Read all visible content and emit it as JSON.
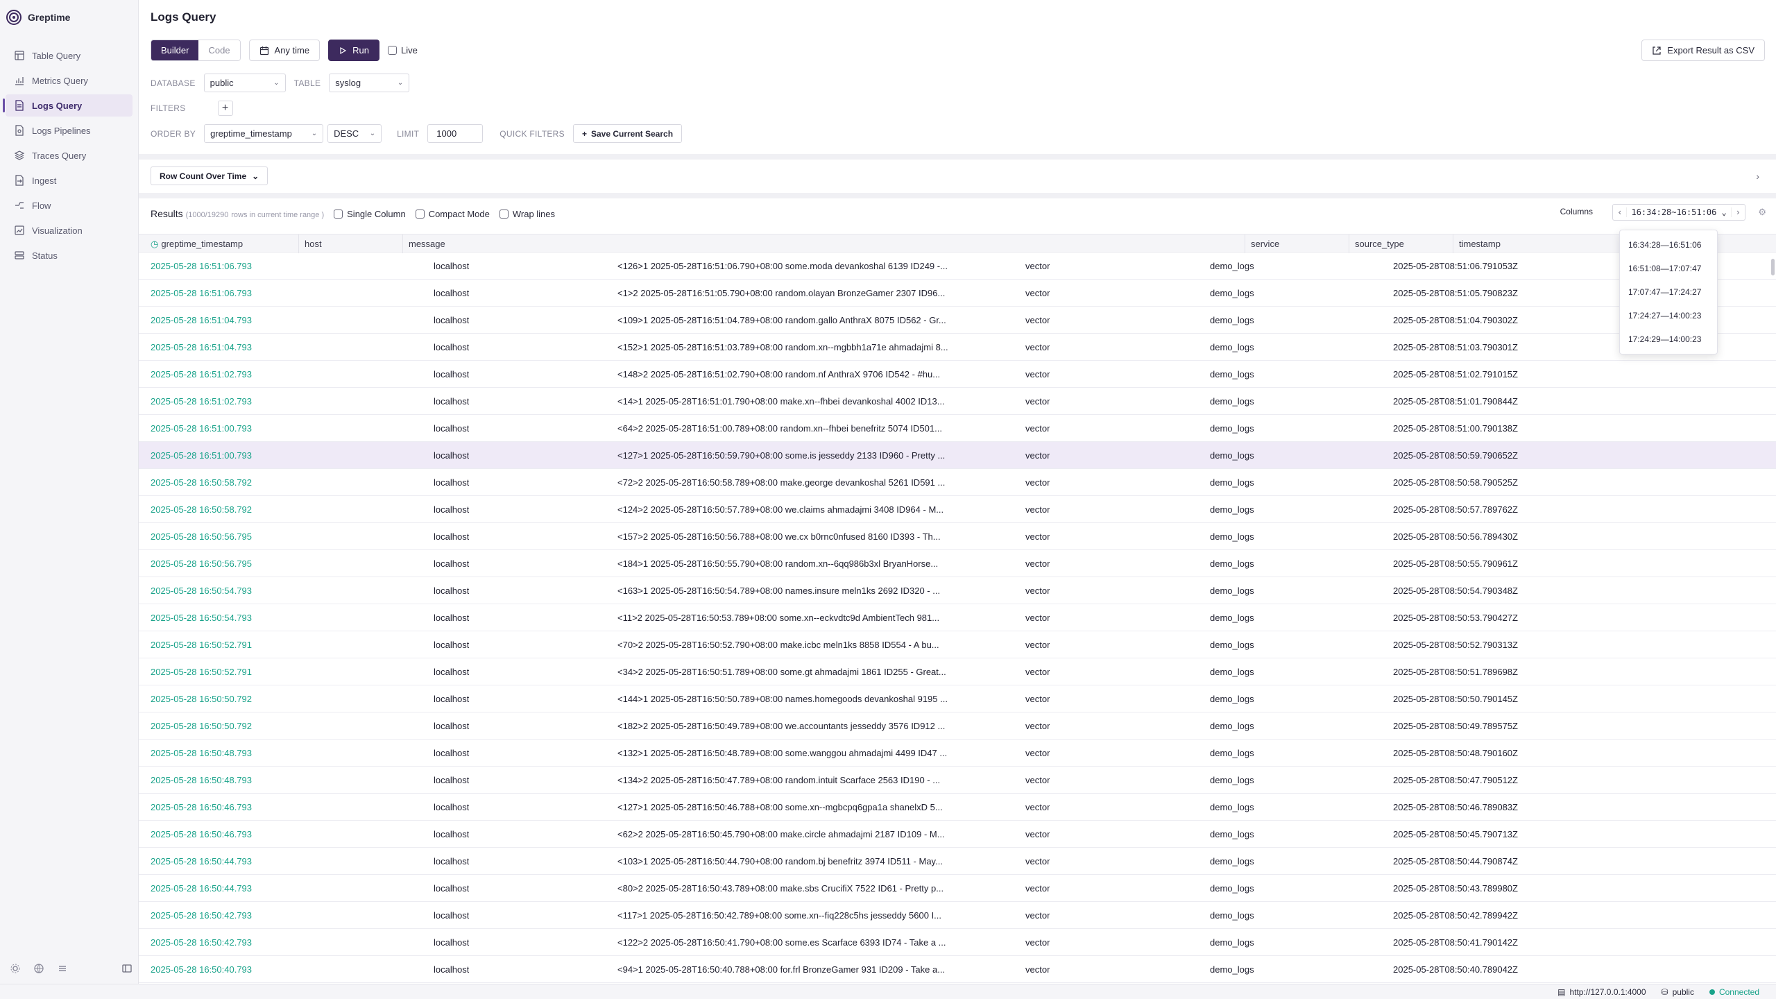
{
  "app": {
    "name": "Greptime"
  },
  "sidebar": {
    "items": [
      {
        "label": "Table Query",
        "icon": "table-icon"
      },
      {
        "label": "Metrics Query",
        "icon": "chart-icon"
      },
      {
        "label": "Logs Query",
        "icon": "document-icon",
        "active": true
      },
      {
        "label": "Logs Pipelines",
        "icon": "pipeline-icon"
      },
      {
        "label": "Traces Query",
        "icon": "layers-icon"
      },
      {
        "label": "Ingest",
        "icon": "ingest-icon"
      },
      {
        "label": "Flow",
        "icon": "flow-icon"
      },
      {
        "label": "Visualization",
        "icon": "visualization-icon"
      },
      {
        "label": "Status",
        "icon": "status-icon"
      }
    ]
  },
  "page": {
    "title": "Logs Query"
  },
  "toolbar": {
    "builder": "Builder",
    "code": "Code",
    "any_time": "Any time",
    "run": "Run",
    "live": "Live",
    "export": "Export Result as CSV"
  },
  "query": {
    "database_label": "DATABASE",
    "database": "public",
    "table_label": "TABLE",
    "table": "syslog",
    "filters_label": "FILTERS",
    "order_by_label": "ORDER BY",
    "order_by": "greptime_timestamp",
    "order": "DESC",
    "limit_label": "LIMIT",
    "limit": "1000",
    "quick_filters_label": "QUICK FILTERS",
    "save_search": "Save Current Search"
  },
  "chart_toggle": {
    "label": "Row Count Over Time"
  },
  "results": {
    "title": "Results",
    "count": "(1000/19290",
    "count_suffix": "rows in current time range )",
    "single_column": "Single Column",
    "compact_mode": "Compact Mode",
    "wrap_lines": "Wrap lines",
    "columns": "Columns",
    "range": "16:34:28~16:51:06",
    "range_options": [
      "16:34:28—16:51:06",
      "16:51:08—17:07:47",
      "17:07:47—17:24:27",
      "17:24:27—14:00:23",
      "17:24:29—14:00:23"
    ]
  },
  "table": {
    "headers": [
      "greptime_timestamp",
      "host",
      "message",
      "service",
      "source_type",
      "timestamp"
    ],
    "rows": [
      [
        "2025-05-28 16:51:06.793",
        "localhost",
        "<126>1 2025-05-28T16:51:06.790+08:00 some.moda devankoshal 6139 ID249 -...",
        "vector",
        "demo_logs",
        "2025-05-28T08:51:06.791053Z"
      ],
      [
        "2025-05-28 16:51:06.793",
        "localhost",
        "<1>2 2025-05-28T16:51:05.790+08:00 random.olayan BronzeGamer 2307 ID96...",
        "vector",
        "demo_logs",
        "2025-05-28T08:51:05.790823Z"
      ],
      [
        "2025-05-28 16:51:04.793",
        "localhost",
        "<109>1 2025-05-28T16:51:04.789+08:00 random.gallo AnthraX 8075 ID562 - Gr...",
        "vector",
        "demo_logs",
        "2025-05-28T08:51:04.790302Z"
      ],
      [
        "2025-05-28 16:51:04.793",
        "localhost",
        "<152>1 2025-05-28T16:51:03.789+08:00 random.xn--mgbbh1a71e ahmadajmi 8...",
        "vector",
        "demo_logs",
        "2025-05-28T08:51:03.790301Z"
      ],
      [
        "2025-05-28 16:51:02.793",
        "localhost",
        "<148>2 2025-05-28T16:51:02.790+08:00 random.nf AnthraX 9706 ID542 - #hu...",
        "vector",
        "demo_logs",
        "2025-05-28T08:51:02.791015Z"
      ],
      [
        "2025-05-28 16:51:02.793",
        "localhost",
        "<14>1 2025-05-28T16:51:01.790+08:00 make.xn--fhbei devankoshal 4002 ID13...",
        "vector",
        "demo_logs",
        "2025-05-28T08:51:01.790844Z"
      ],
      [
        "2025-05-28 16:51:00.793",
        "localhost",
        "<64>2 2025-05-28T16:51:00.789+08:00 random.xn--fhbei benefritz 5074 ID501...",
        "vector",
        "demo_logs",
        "2025-05-28T08:51:00.790138Z"
      ],
      [
        "2025-05-28 16:51:00.793",
        "localhost",
        "<127>1 2025-05-28T16:50:59.790+08:00 some.is jesseddy 2133 ID960 - Pretty ...",
        "vector",
        "demo_logs",
        "2025-05-28T08:50:59.790652Z"
      ],
      [
        "2025-05-28 16:50:58.792",
        "localhost",
        "<72>2 2025-05-28T16:50:58.789+08:00 make.george devankoshal 5261 ID591 ...",
        "vector",
        "demo_logs",
        "2025-05-28T08:50:58.790525Z"
      ],
      [
        "2025-05-28 16:50:58.792",
        "localhost",
        "<124>2 2025-05-28T16:50:57.789+08:00 we.claims ahmadajmi 3408 ID964 - M...",
        "vector",
        "demo_logs",
        "2025-05-28T08:50:57.789762Z"
      ],
      [
        "2025-05-28 16:50:56.795",
        "localhost",
        "<157>2 2025-05-28T16:50:56.788+08:00 we.cx b0rnc0nfused 8160 ID393 - Th...",
        "vector",
        "demo_logs",
        "2025-05-28T08:50:56.789430Z"
      ],
      [
        "2025-05-28 16:50:56.795",
        "localhost",
        "<184>1 2025-05-28T16:50:55.790+08:00 random.xn--6qq986b3xl BryanHorse...",
        "vector",
        "demo_logs",
        "2025-05-28T08:50:55.790961Z"
      ],
      [
        "2025-05-28 16:50:54.793",
        "localhost",
        "<163>1 2025-05-28T16:50:54.789+08:00 names.insure meln1ks 2692 ID320 - ...",
        "vector",
        "demo_logs",
        "2025-05-28T08:50:54.790348Z"
      ],
      [
        "2025-05-28 16:50:54.793",
        "localhost",
        "<11>2 2025-05-28T16:50:53.789+08:00 some.xn--eckvdtc9d AmbientTech 981...",
        "vector",
        "demo_logs",
        "2025-05-28T08:50:53.790427Z"
      ],
      [
        "2025-05-28 16:50:52.791",
        "localhost",
        "<70>2 2025-05-28T16:50:52.790+08:00 make.icbc meln1ks 8858 ID554 - A bu...",
        "vector",
        "demo_logs",
        "2025-05-28T08:50:52.790313Z"
      ],
      [
        "2025-05-28 16:50:52.791",
        "localhost",
        "<34>2 2025-05-28T16:50:51.789+08:00 some.gt ahmadajmi 1861 ID255 - Great...",
        "vector",
        "demo_logs",
        "2025-05-28T08:50:51.789698Z"
      ],
      [
        "2025-05-28 16:50:50.792",
        "localhost",
        "<144>1 2025-05-28T16:50:50.789+08:00 names.homegoods devankoshal 9195 ...",
        "vector",
        "demo_logs",
        "2025-05-28T08:50:50.790145Z"
      ],
      [
        "2025-05-28 16:50:50.792",
        "localhost",
        "<182>2 2025-05-28T16:50:49.789+08:00 we.accountants jesseddy 3576 ID912 ...",
        "vector",
        "demo_logs",
        "2025-05-28T08:50:49.789575Z"
      ],
      [
        "2025-05-28 16:50:48.793",
        "localhost",
        "<132>1 2025-05-28T16:50:48.789+08:00 some.wanggou ahmadajmi 4499 ID47 ...",
        "vector",
        "demo_logs",
        "2025-05-28T08:50:48.790160Z"
      ],
      [
        "2025-05-28 16:50:48.793",
        "localhost",
        "<134>2 2025-05-28T16:50:47.789+08:00 random.intuit Scarface 2563 ID190 - ...",
        "vector",
        "demo_logs",
        "2025-05-28T08:50:47.790512Z"
      ],
      [
        "2025-05-28 16:50:46.793",
        "localhost",
        "<127>1 2025-05-28T16:50:46.788+08:00 some.xn--mgbcpq6gpa1a shanelxD 5...",
        "vector",
        "demo_logs",
        "2025-05-28T08:50:46.789083Z"
      ],
      [
        "2025-05-28 16:50:46.793",
        "localhost",
        "<62>2 2025-05-28T16:50:45.790+08:00 make.circle ahmadajmi 2187 ID109 - M...",
        "vector",
        "demo_logs",
        "2025-05-28T08:50:45.790713Z"
      ],
      [
        "2025-05-28 16:50:44.793",
        "localhost",
        "<103>1 2025-05-28T16:50:44.790+08:00 random.bj benefritz 3974 ID511 - May...",
        "vector",
        "demo_logs",
        "2025-05-28T08:50:44.790874Z"
      ],
      [
        "2025-05-28 16:50:44.793",
        "localhost",
        "<80>2 2025-05-28T16:50:43.789+08:00 make.sbs CrucifiX 7522 ID61 - Pretty p...",
        "vector",
        "demo_logs",
        "2025-05-28T08:50:43.789980Z"
      ],
      [
        "2025-05-28 16:50:42.793",
        "localhost",
        "<117>1 2025-05-28T16:50:42.789+08:00 some.xn--fiq228c5hs jesseddy 5600 I...",
        "vector",
        "demo_logs",
        "2025-05-28T08:50:42.789942Z"
      ],
      [
        "2025-05-28 16:50:42.793",
        "localhost",
        "<122>2 2025-05-28T16:50:41.790+08:00 some.es Scarface 6393 ID74 - Take a ...",
        "vector",
        "demo_logs",
        "2025-05-28T08:50:41.790142Z"
      ],
      [
        "2025-05-28 16:50:40.793",
        "localhost",
        "<94>1 2025-05-28T16:50:40.788+08:00 for.frl BronzeGamer 931 ID209 - Take a...",
        "vector",
        "demo_logs",
        "2025-05-28T08:50:40.789042Z"
      ]
    ]
  },
  "statusbar": {
    "url": "http://127.0.0.1:4000",
    "db": "public",
    "status": "Connected"
  },
  "colors": {
    "accent": "#3d2a5e",
    "timestamp": "#1aa38a",
    "highlight": "#efeaf7"
  }
}
